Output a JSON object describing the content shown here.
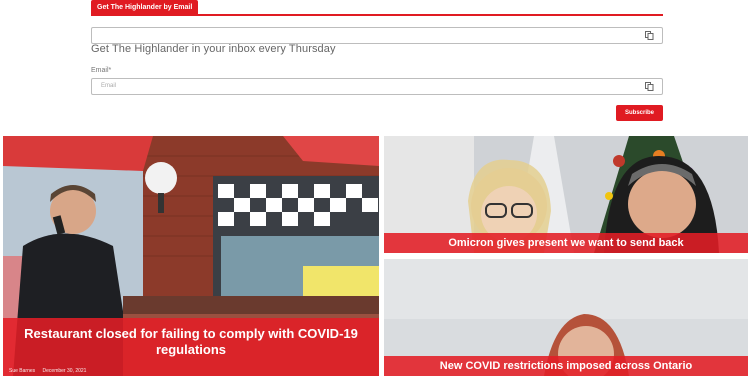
{
  "newsletter": {
    "tab_label": "Get The Highlander by Email",
    "top_field_placeholder": "",
    "description": "Get The Highlander in your inbox every Thursday",
    "email_label": "Email*",
    "email_placeholder": "Email",
    "subscribe_label": "Subscribe"
  },
  "stories": [
    {
      "headline": "Restaurant closed for failing to comply with COVID-19 regulations",
      "author": "Sue Barnes",
      "date": "December 30, 2021"
    },
    {
      "headline": "Omicron gives present we want to send back"
    },
    {
      "headline": "New COVID restrictions imposed across Ontario"
    }
  ],
  "colors": {
    "accent": "#e01b22"
  },
  "icons": [
    "field-autofill-icon"
  ]
}
